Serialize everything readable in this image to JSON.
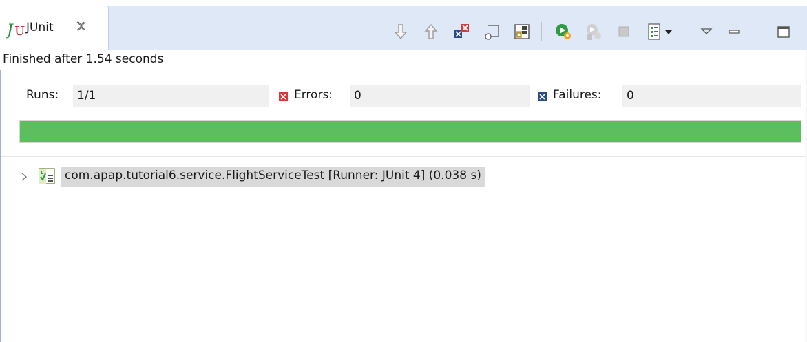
{
  "view": {
    "tab_title": "JUnit",
    "icons": {
      "tab": "junit-icon",
      "close": "close-icon"
    }
  },
  "toolbar": {
    "items": [
      {
        "name": "next-failure-icon"
      },
      {
        "name": "previous-failure-icon"
      },
      {
        "name": "show-failures-only-icon"
      },
      {
        "name": "scroll-lock-icon"
      },
      {
        "name": "show-skipped-icon"
      },
      {
        "name": "rerun-test-icon"
      },
      {
        "name": "rerun-failed-first-icon"
      },
      {
        "name": "stop-icon"
      },
      {
        "name": "test-run-history-icon"
      },
      {
        "name": "history-dropdown-icon"
      },
      {
        "name": "view-menu-icon"
      },
      {
        "name": "minimize-icon"
      },
      {
        "name": "maximize-icon"
      }
    ]
  },
  "status": {
    "text": "Finished after 1.54 seconds"
  },
  "counters": {
    "runs_label": "Runs:",
    "runs_value": "1/1",
    "errors_label": "Errors:",
    "errors_value": "0",
    "failures_label": "Failures:",
    "failures_value": "0"
  },
  "progress": {
    "fraction": 1.0,
    "color": "#5cbe5e"
  },
  "tree": {
    "items": [
      {
        "label": "com.apap.tutorial6.service.FlightServiceTest [Runner: JUnit 4] (0.038 s)",
        "icon": "test-suite-success-icon",
        "expanded": false
      }
    ]
  },
  "colors": {
    "tabbar_bg": "#dfe8f6",
    "selection": "#d9d9d9",
    "error_red": "#d9383a",
    "failure_blue": "#2b4a8a"
  }
}
